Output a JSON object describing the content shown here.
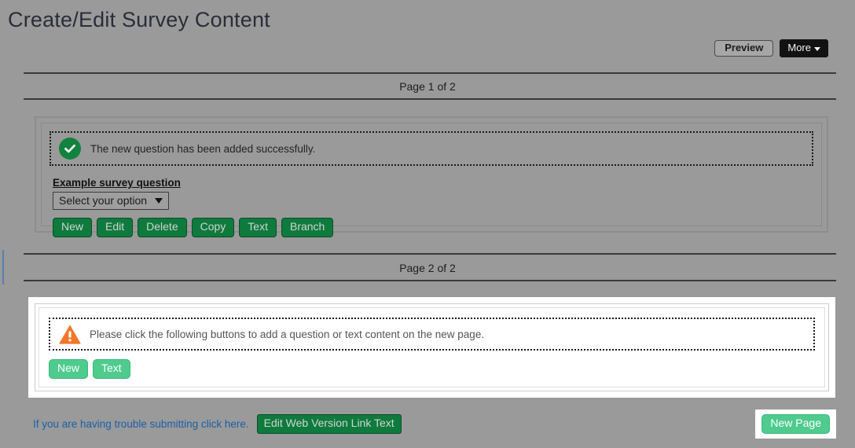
{
  "header": {
    "title": "Create/Edit Survey Content",
    "preview_label": "Preview",
    "more_label": "More"
  },
  "pages": [
    {
      "label": "Page 1 of 2",
      "message": {
        "icon": "success-check-icon",
        "text": "The new question has been added successfully."
      },
      "question": {
        "label": "Example survey question",
        "select_value": "Select your option"
      },
      "buttons": [
        "New",
        "Edit",
        "Delete",
        "Copy",
        "Text",
        "Branch"
      ]
    },
    {
      "label": "Page 2 of 2",
      "message": {
        "icon": "warning-triangle-icon",
        "text": "Please click the following buttons to add a question or text content on the new page."
      },
      "buttons": [
        "New",
        "Text"
      ]
    }
  ],
  "footer": {
    "link_text": "If you are having trouble submitting click here.",
    "edit_weblink_label": "Edit Web Version Link Text",
    "new_page_label": "New Page"
  },
  "colors": {
    "page_background": "#9a9a9a",
    "button_green_dark": "#0f7a3d",
    "button_green_light": "#4ecb8d",
    "success_green": "#12823f",
    "warning_orange": "#f2772a",
    "link_blue": "#1c5fa8",
    "more_button_black": "#121212"
  }
}
